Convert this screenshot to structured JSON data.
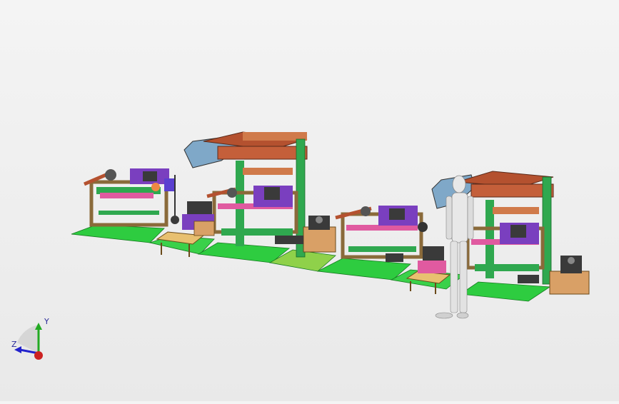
{
  "viewport": {
    "background_colors": [
      "#f4f4f4",
      "#e9e9e9"
    ],
    "assembly": {
      "floor_color": "#2ecc40",
      "frame_color": "#2fa84f",
      "belt_color": "#b4512f",
      "roller_color": "#7a3fbf",
      "motor_color": "#3a3a3a",
      "box_color": "#d9a066",
      "human_figure_color": "#e8e8e8"
    }
  },
  "triad": {
    "y_label": "Y",
    "z_label": "Z",
    "y_color": "#22aa22",
    "z_color": "#2222cc",
    "x_color": "#cc2222"
  }
}
